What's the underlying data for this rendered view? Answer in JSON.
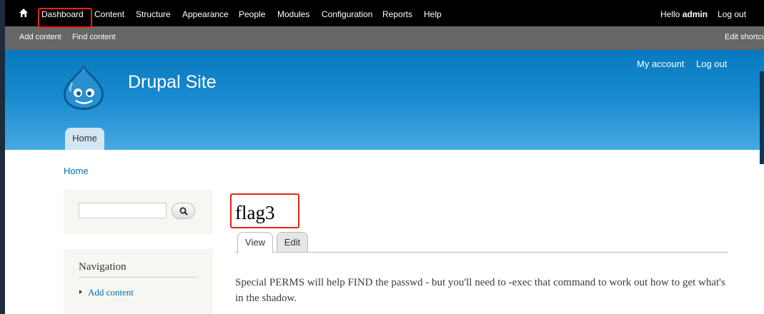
{
  "toolbar": {
    "home_icon": "home-icon",
    "menu": [
      "Dashboard",
      "Content",
      "Structure",
      "Appearance",
      "People",
      "Modules",
      "Configuration",
      "Reports",
      "Help"
    ],
    "hello_prefix": "Hello ",
    "user": "admin",
    "logout": "Log out"
  },
  "shortcuts": {
    "items": [
      "Add content",
      "Find content"
    ],
    "edit": "Edit shortcuts"
  },
  "header": {
    "site_name": "Drupal Site",
    "secondary_menu": [
      "My account",
      "Log out"
    ],
    "main_menu": [
      "Home"
    ]
  },
  "breadcrumb": "Home",
  "sidebar": {
    "search_icon": "search-icon",
    "nav_title": "Navigation",
    "nav_items": [
      "Add content"
    ]
  },
  "node": {
    "title": "flag3",
    "tabs": [
      "View",
      "Edit"
    ],
    "body": "Special PERMS will help FIND the passwd - but you'll need to -exec that command to work out how to get what's in the shadow."
  },
  "colors": {
    "annotation": "#e2231a",
    "link": "#0071b3",
    "header_top": "#0779bf",
    "header_bottom": "#48a9e4"
  }
}
